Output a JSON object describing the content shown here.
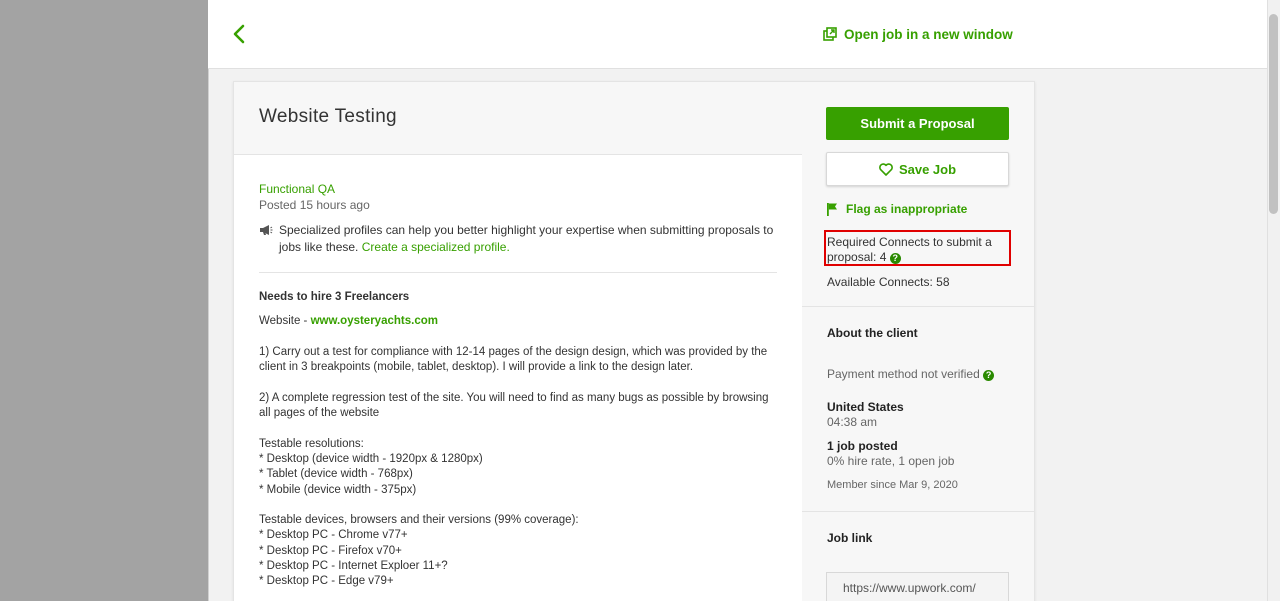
{
  "topbar": {
    "open_new_label": "Open job in a new window"
  },
  "job": {
    "title": "Website Testing",
    "category": "Functional QA",
    "posted": "Posted 15 hours ago",
    "tip_text": "Specialized profiles can help you better highlight your expertise when submitting proposals to jobs like these.",
    "tip_link": "Create a specialized profile.",
    "needs": "Needs to hire 3 Freelancers",
    "website_prefix": "Website - ",
    "website_link": "www.oysteryachts.com",
    "para1": "1) Carry out a test for compliance with 12-14 pages of the design design, which was provided by the client in 3 breakpoints (mobile, tablet, desktop). I will provide a link to the design later.",
    "para2": "2) A complete regression test of the site. You will need to find as many bugs as possible by browsing all pages of the website",
    "resolutions_title": "Testable resolutions:",
    "resolutions": [
      "* Desktop (device width - 1920px & 1280px)",
      "* Tablet (device width - 768px)",
      "* Mobile (device width - 375px)"
    ],
    "devices_title": "Testable devices, browsers and their versions (99% coverage):",
    "devices": [
      "* Desktop PC - Chrome v77+",
      "* Desktop PC - Firefox v70+",
      "* Desktop PC - Internet Exploer 11+?",
      "* Desktop PC - Edge v79+"
    ]
  },
  "sidebar": {
    "submit_label": "Submit a Proposal",
    "save_label": "Save Job",
    "flag_label": "Flag as inappropriate",
    "connects_required": "Required Connects to submit a proposal: 4",
    "connects_available": "Available Connects: 58",
    "help_glyph": "?"
  },
  "client": {
    "section_title": "About the client",
    "payment": "Payment method not verified",
    "country": "United States",
    "time": "04:38 am",
    "jobs_posted": "1 job posted",
    "hire_rate": "0% hire rate, 1 open job",
    "member_since": "Member since Mar 9, 2020"
  },
  "job_link": {
    "section_title": "Job link",
    "value": "https://www.upwork.com/"
  },
  "colors": {
    "accent": "#37a000",
    "highlight_border": "#e00000"
  }
}
